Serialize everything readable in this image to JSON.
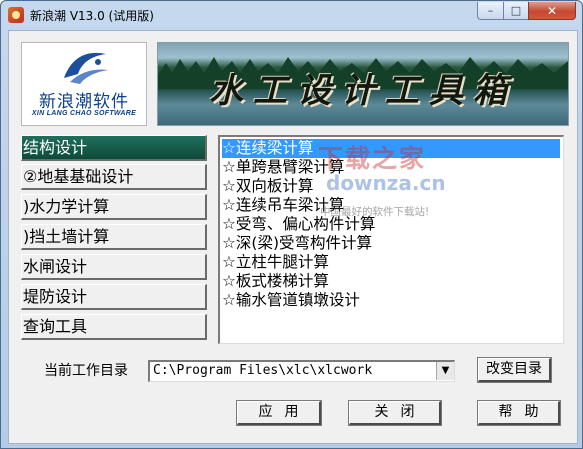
{
  "window": {
    "title": "新浪潮 V13.0 (试用版)",
    "controls": {
      "minimize": "–",
      "maximize": "□",
      "close": "✕"
    }
  },
  "logo": {
    "name": "新浪潮软件",
    "subtitle": "XIN LANG CHAO SOFTWARE",
    "icon": "wave-logo-icon"
  },
  "banner": {
    "title": "水工设计工具箱"
  },
  "nav": {
    "items": [
      {
        "label": "结构设计",
        "active": true
      },
      {
        "label": "②地基基础设计",
        "active": false
      },
      {
        "label": ")水力学计算",
        "active": false
      },
      {
        "label": ")挡土墙计算",
        "active": false
      },
      {
        "label": "水闸设计",
        "active": false
      },
      {
        "label": "堤防设计",
        "active": false
      },
      {
        "label": "查询工具",
        "active": false
      }
    ]
  },
  "list": {
    "items": [
      {
        "label": "☆连续梁计算",
        "selected": true
      },
      {
        "label": "☆单跨悬臂梁计算",
        "selected": false
      },
      {
        "label": "☆双向板计算",
        "selected": false
      },
      {
        "label": "☆连续吊车梁计算",
        "selected": false
      },
      {
        "label": "☆受弯、偏心构件计算",
        "selected": false
      },
      {
        "label": "☆深(梁)受弯构件计算",
        "selected": false
      },
      {
        "label": "☆立柱牛腿计算",
        "selected": false
      },
      {
        "label": "☆板式楼梯计算",
        "selected": false
      },
      {
        "label": "☆输水管道镇墩设计",
        "selected": false
      }
    ]
  },
  "watermark": {
    "cn": "下载之家",
    "url": "downza.cn",
    "tag": "中国最好的软件下载站!"
  },
  "workdir": {
    "label": "当前工作目录",
    "value": "C:\\Program Files\\xlc\\xlcwork",
    "change_button": "改变目录"
  },
  "footer": {
    "apply": "应用",
    "close": "关闭",
    "help": "帮助"
  },
  "colors": {
    "nav_active": "#0e4a3c",
    "list_selection": "#3399ff",
    "close_button": "#c44a32"
  }
}
